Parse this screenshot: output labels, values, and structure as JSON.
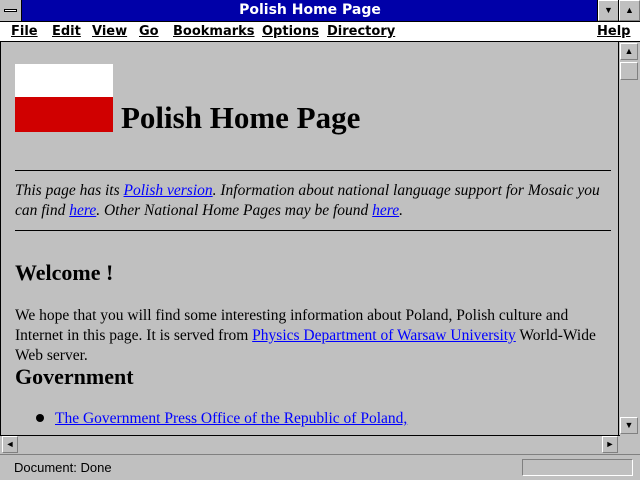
{
  "window": {
    "title": "Polish Home Page",
    "minimize_glyph": "▼",
    "maximize_glyph": "▲"
  },
  "menu": [
    {
      "name": "menu-file",
      "label": "File"
    },
    {
      "name": "menu-edit",
      "label": "Edit"
    },
    {
      "name": "menu-view",
      "label": "View"
    },
    {
      "name": "menu-go",
      "label": "Go"
    },
    {
      "name": "menu-bookmarks",
      "label": "Bookmarks"
    },
    {
      "name": "menu-options",
      "label": "Options"
    },
    {
      "name": "menu-directory",
      "label": "Directory"
    },
    {
      "name": "menu-help",
      "label": "Help"
    }
  ],
  "page": {
    "flag_colors": {
      "top": "#ffffff",
      "bottom": "#d00000"
    },
    "title": "Polish Home Page",
    "intro": {
      "t1": "This page has its ",
      "link1": "Polish version",
      "t2": ". Information about national language support for Mosaic you can find ",
      "link2": "here",
      "t3": ". Other National Home Pages may be found ",
      "link3": "here",
      "t4": "."
    },
    "welcome_heading": "Welcome !",
    "welcome_text": {
      "t1": "We hope that you will find some interesting information about Poland, Polish culture and Internet in this page. It is served from ",
      "link": "Physics Department of Warsaw University",
      "t2": " World-Wide Web server."
    },
    "gov_heading": "Government",
    "gov_items": [
      "The Government Press Office of the Republic of Poland,"
    ]
  },
  "scrollbars": {
    "up_glyph": "▲",
    "down_glyph": "▼",
    "left_glyph": "◄",
    "right_glyph": "►"
  },
  "status": {
    "text": "Document: Done"
  }
}
